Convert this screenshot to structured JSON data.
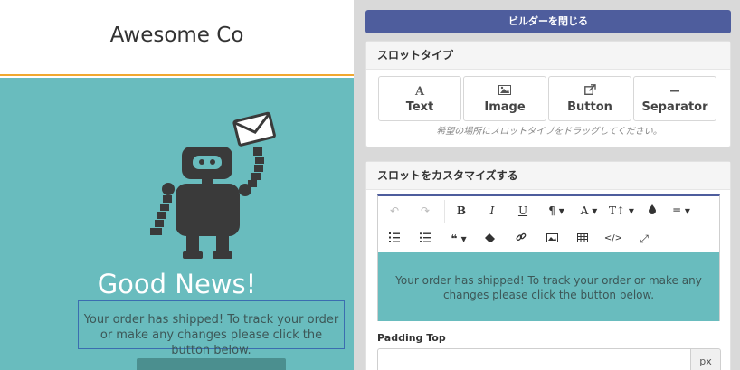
{
  "preview": {
    "company_name": "Awesome Co",
    "hero_title": "Good News!",
    "hero_body": "Your order has shipped! To track your order or make any changes please click the button below.",
    "colors": {
      "hero_bg": "#69bcbe",
      "header_border": "#f0a830",
      "robot": "#3a3a3a"
    }
  },
  "builder": {
    "close_label": "ビルダーを閉じる",
    "slot_type": {
      "title": "スロットタイプ",
      "items": [
        {
          "label": "Text",
          "icon": "text-icon"
        },
        {
          "label": "Image",
          "icon": "image-icon"
        },
        {
          "label": "Button",
          "icon": "external-link-icon"
        },
        {
          "label": "Separator",
          "icon": "minus-icon"
        }
      ],
      "hint": "希望の場所にスロットタイプをドラッグしてください。"
    },
    "customize": {
      "title": "スロットをカスタマイズする",
      "toolbar_icons": [
        "undo-icon",
        "redo-icon",
        "bold-icon",
        "italic-icon",
        "underline-icon",
        "paragraph-icon",
        "font-color-icon",
        "font-size-icon",
        "background-color-icon",
        "align-icon",
        "ordered-list-icon",
        "unordered-list-icon",
        "quote-icon",
        "eraser-icon",
        "link-icon",
        "image-icon",
        "table-icon",
        "code-view-icon",
        "fullscreen-icon"
      ],
      "editor_text": "Your order has shipped! To track your order or make any changes please click the button below.",
      "padding_label": "Padding Top",
      "padding_value": "",
      "padding_unit": "px"
    },
    "colors": {
      "accent": "#4e5d9d"
    }
  }
}
